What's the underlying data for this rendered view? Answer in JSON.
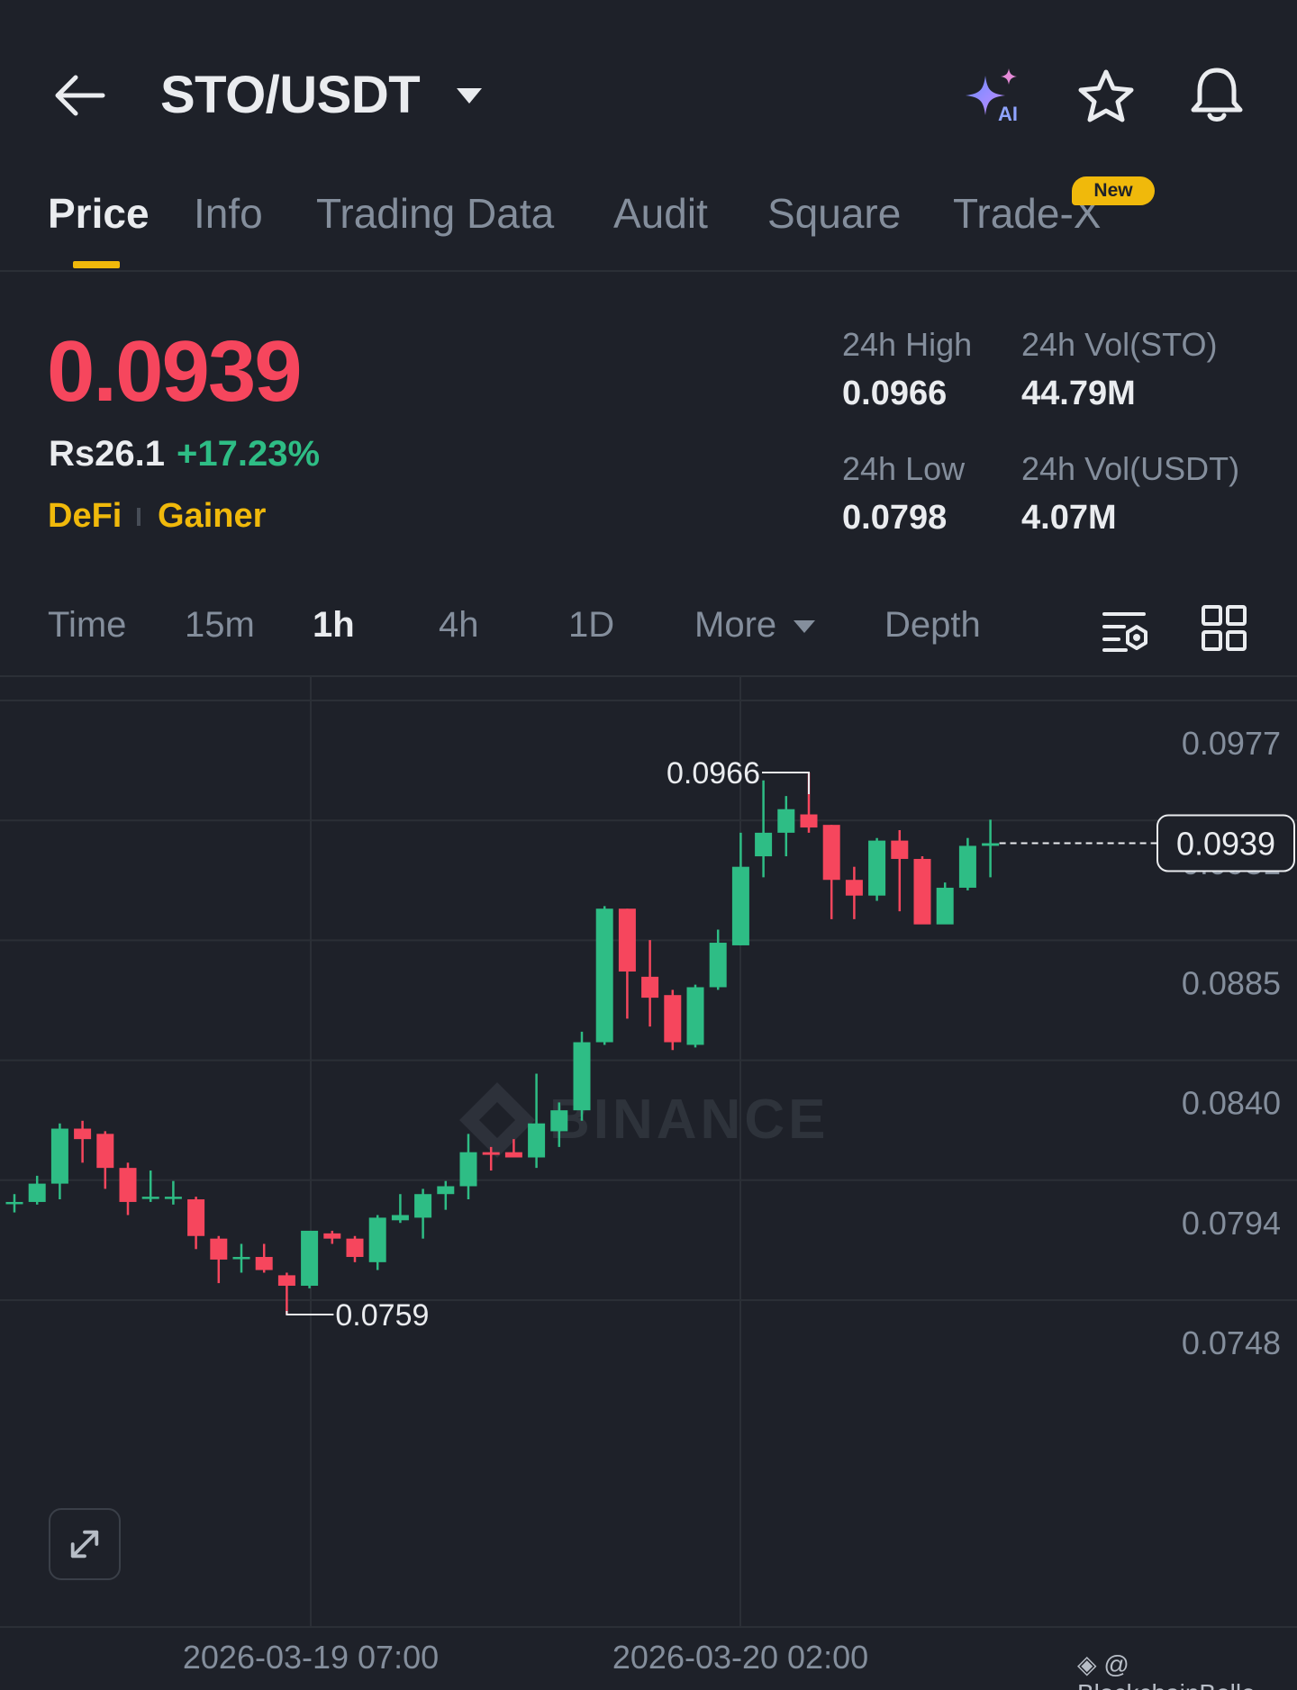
{
  "header": {
    "pair": "STO/USDT",
    "ai_label": "AI"
  },
  "tabs": [
    {
      "label": "Price",
      "active": true
    },
    {
      "label": "Info"
    },
    {
      "label": "Trading Data"
    },
    {
      "label": "Audit"
    },
    {
      "label": "Square"
    },
    {
      "label": "Trade-X",
      "badge": "New"
    }
  ],
  "ticker": {
    "last_price": "0.0939",
    "fiat_price": "Rs26.1",
    "change_pct": "+17.23%",
    "tags": [
      "DeFi",
      "Gainer"
    ],
    "stats": [
      {
        "label": "24h High",
        "value": "0.0966"
      },
      {
        "label": "24h Vol(STO)",
        "value": "44.79M"
      },
      {
        "label": "24h Low",
        "value": "0.0798"
      },
      {
        "label": "24h Vol(USDT)",
        "value": "4.07M"
      }
    ]
  },
  "intervals": {
    "items": [
      "Time",
      "15m",
      "1h",
      "4h",
      "1D",
      "More",
      "Depth"
    ],
    "active": "1h"
  },
  "colors": {
    "up": "#2ebd85",
    "down": "#f6465d",
    "accent": "#f0b90b",
    "background": "#1e2129"
  },
  "icons": [
    "back-arrow-icon",
    "dropdown-caret-icon",
    "ai-sparkle-icon",
    "star-icon",
    "bell-icon",
    "indicator-settings-icon",
    "grid-layout-icon",
    "expand-icon"
  ],
  "chart_data": {
    "type": "candlestick",
    "interval": "1h",
    "y_ticks": [
      "0.0977",
      "0.0931",
      "0.0885",
      "0.0840",
      "0.0794",
      "0.0748"
    ],
    "x_ticks": [
      "2026-03-19 07:00",
      "2026-03-20 02:00"
    ],
    "ylim": [
      0.0748,
      0.0977
    ],
    "current_price": "0.0939",
    "high_marker": "0.0966",
    "low_marker": "0.0759",
    "watermark": "BINANCE",
    "candles": [
      {
        "o": 0.0802,
        "h": 0.0805,
        "l": 0.0798,
        "c": 0.0802
      },
      {
        "o": 0.0802,
        "h": 0.0812,
        "l": 0.0801,
        "c": 0.0809
      },
      {
        "o": 0.0809,
        "h": 0.0832,
        "l": 0.0803,
        "c": 0.083
      },
      {
        "o": 0.083,
        "h": 0.0833,
        "l": 0.0817,
        "c": 0.0826
      },
      {
        "o": 0.0828,
        "h": 0.0829,
        "l": 0.0807,
        "c": 0.0815
      },
      {
        "o": 0.0815,
        "h": 0.0817,
        "l": 0.0797,
        "c": 0.0802
      },
      {
        "o": 0.0804,
        "h": 0.0814,
        "l": 0.0802,
        "c": 0.0804
      },
      {
        "o": 0.0804,
        "h": 0.081,
        "l": 0.0801,
        "c": 0.0804
      },
      {
        "o": 0.0803,
        "h": 0.0804,
        "l": 0.0784,
        "c": 0.0789
      },
      {
        "o": 0.0788,
        "h": 0.0789,
        "l": 0.0771,
        "c": 0.078
      },
      {
        "o": 0.0781,
        "h": 0.0786,
        "l": 0.0775,
        "c": 0.0781
      },
      {
        "o": 0.0781,
        "h": 0.0786,
        "l": 0.0775,
        "c": 0.0776
      },
      {
        "o": 0.0774,
        "h": 0.0775,
        "l": 0.0759,
        "c": 0.077
      },
      {
        "o": 0.077,
        "h": 0.0791,
        "l": 0.0769,
        "c": 0.0791
      },
      {
        "o": 0.079,
        "h": 0.0791,
        "l": 0.0786,
        "c": 0.0788
      },
      {
        "o": 0.0788,
        "h": 0.0789,
        "l": 0.0779,
        "c": 0.0781
      },
      {
        "o": 0.0779,
        "h": 0.0797,
        "l": 0.0776,
        "c": 0.0796
      },
      {
        "o": 0.0795,
        "h": 0.0805,
        "l": 0.0794,
        "c": 0.0797
      },
      {
        "o": 0.0796,
        "h": 0.0807,
        "l": 0.0788,
        "c": 0.0805
      },
      {
        "o": 0.0805,
        "h": 0.081,
        "l": 0.0799,
        "c": 0.0808
      },
      {
        "o": 0.0808,
        "h": 0.0828,
        "l": 0.0803,
        "c": 0.0821
      },
      {
        "o": 0.0821,
        "h": 0.0823,
        "l": 0.0814,
        "c": 0.082
      },
      {
        "o": 0.0821,
        "h": 0.0826,
        "l": 0.0819,
        "c": 0.0819
      },
      {
        "o": 0.0819,
        "h": 0.0851,
        "l": 0.0815,
        "c": 0.0832
      },
      {
        "o": 0.0829,
        "h": 0.084,
        "l": 0.0823,
        "c": 0.0837
      },
      {
        "o": 0.0837,
        "h": 0.0867,
        "l": 0.0833,
        "c": 0.0863
      },
      {
        "o": 0.0863,
        "h": 0.0915,
        "l": 0.0862,
        "c": 0.0914
      },
      {
        "o": 0.0914,
        "h": 0.0914,
        "l": 0.0872,
        "c": 0.089
      },
      {
        "o": 0.0888,
        "h": 0.0902,
        "l": 0.0869,
        "c": 0.088
      },
      {
        "o": 0.0881,
        "h": 0.0883,
        "l": 0.086,
        "c": 0.0863
      },
      {
        "o": 0.0862,
        "h": 0.0885,
        "l": 0.0861,
        "c": 0.0884
      },
      {
        "o": 0.0884,
        "h": 0.0906,
        "l": 0.0883,
        "c": 0.0901
      },
      {
        "o": 0.09,
        "h": 0.0943,
        "l": 0.09,
        "c": 0.093
      },
      {
        "o": 0.0934,
        "h": 0.0963,
        "l": 0.0926,
        "c": 0.0943
      },
      {
        "o": 0.0943,
        "h": 0.0957,
        "l": 0.0934,
        "c": 0.0952
      },
      {
        "o": 0.095,
        "h": 0.0966,
        "l": 0.0943,
        "c": 0.0945
      },
      {
        "o": 0.0946,
        "h": 0.0946,
        "l": 0.091,
        "c": 0.0925
      },
      {
        "o": 0.0925,
        "h": 0.093,
        "l": 0.091,
        "c": 0.0919
      },
      {
        "o": 0.0919,
        "h": 0.0941,
        "l": 0.0917,
        "c": 0.094
      },
      {
        "o": 0.094,
        "h": 0.0944,
        "l": 0.0913,
        "c": 0.0933
      },
      {
        "o": 0.0933,
        "h": 0.0934,
        "l": 0.091,
        "c": 0.0908
      },
      {
        "o": 0.0908,
        "h": 0.0924,
        "l": 0.091,
        "c": 0.0922
      },
      {
        "o": 0.0922,
        "h": 0.0941,
        "l": 0.0921,
        "c": 0.0938
      },
      {
        "o": 0.0938,
        "h": 0.0948,
        "l": 0.0926,
        "c": 0.0939
      }
    ]
  },
  "credit": "@ BlockchainBelle"
}
